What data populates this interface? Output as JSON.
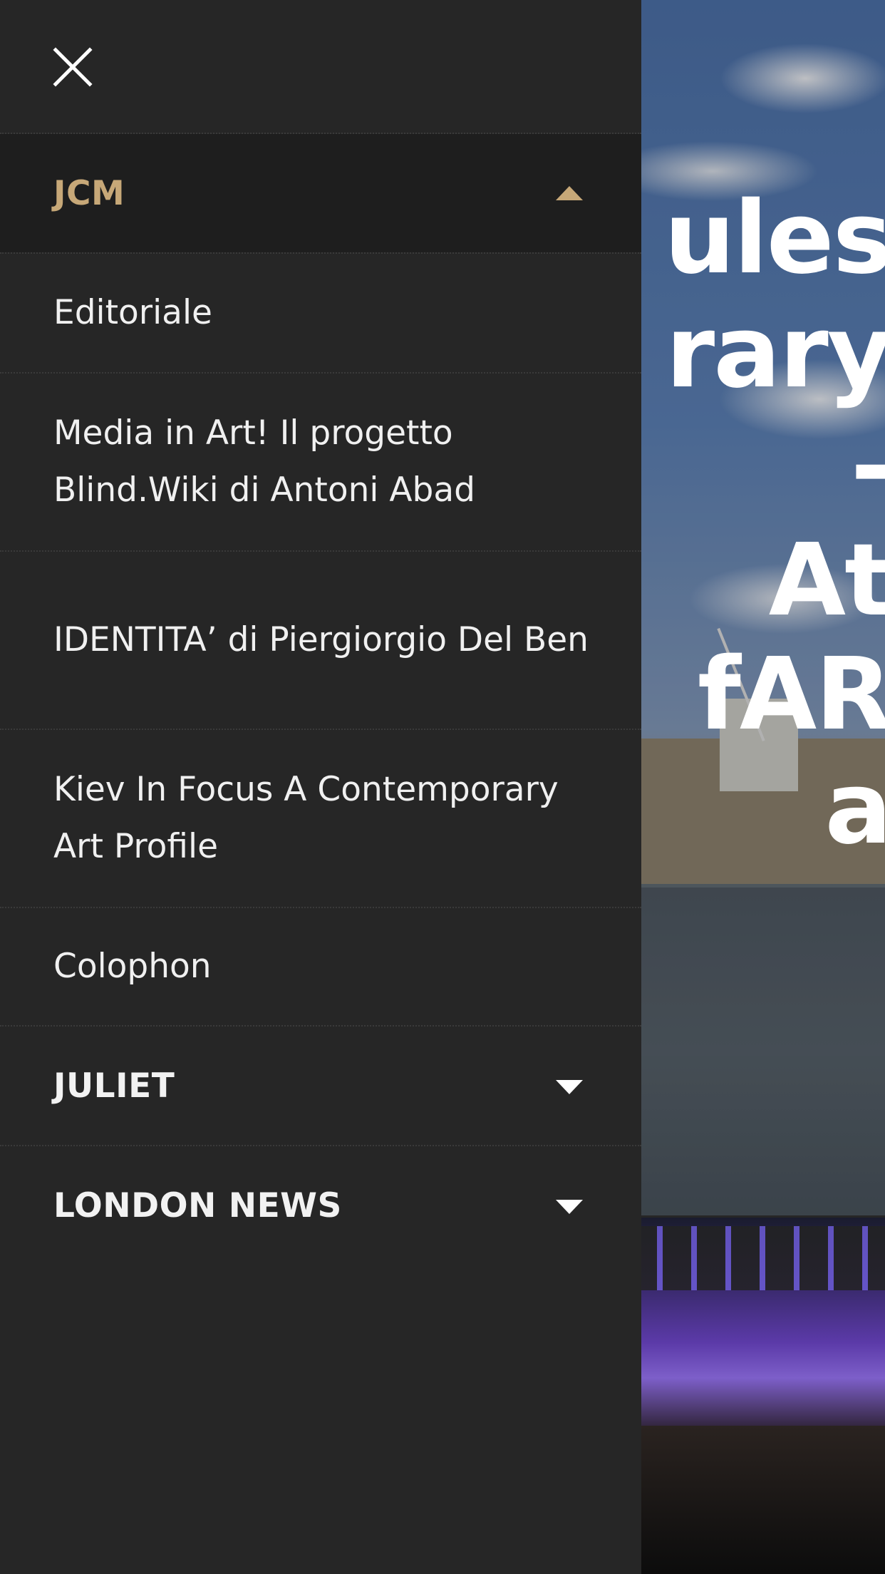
{
  "background": {
    "hero_title_lines": [
      "ules",
      "rary",
      "-",
      "At",
      "fAR",
      "a"
    ]
  },
  "drawer": {
    "close_icon": "close-icon",
    "groups": [
      {
        "label": "JCM",
        "expanded": true,
        "caret_icon": "caret-up-icon",
        "accent": "#c7a878",
        "items": [
          {
            "label": "Editoriale"
          },
          {
            "label": "Media in Art! Il progetto Blind.Wiki di Antoni Abad"
          },
          {
            "label": "IDENTITA’ di Piergiorgio Del Ben"
          },
          {
            "label": "Kiev In Focus A Contemporary Art Profile"
          },
          {
            "label": "Colophon"
          }
        ]
      },
      {
        "label": "JULIET",
        "expanded": false,
        "caret_icon": "caret-down-icon"
      },
      {
        "label": "LONDON NEWS",
        "expanded": false,
        "caret_icon": "caret-down-icon"
      }
    ]
  },
  "colors": {
    "drawer_bg": "#262626",
    "active_group_bg": "#1e1e1e",
    "accent": "#c7a878",
    "text": "#f2f2f2"
  }
}
